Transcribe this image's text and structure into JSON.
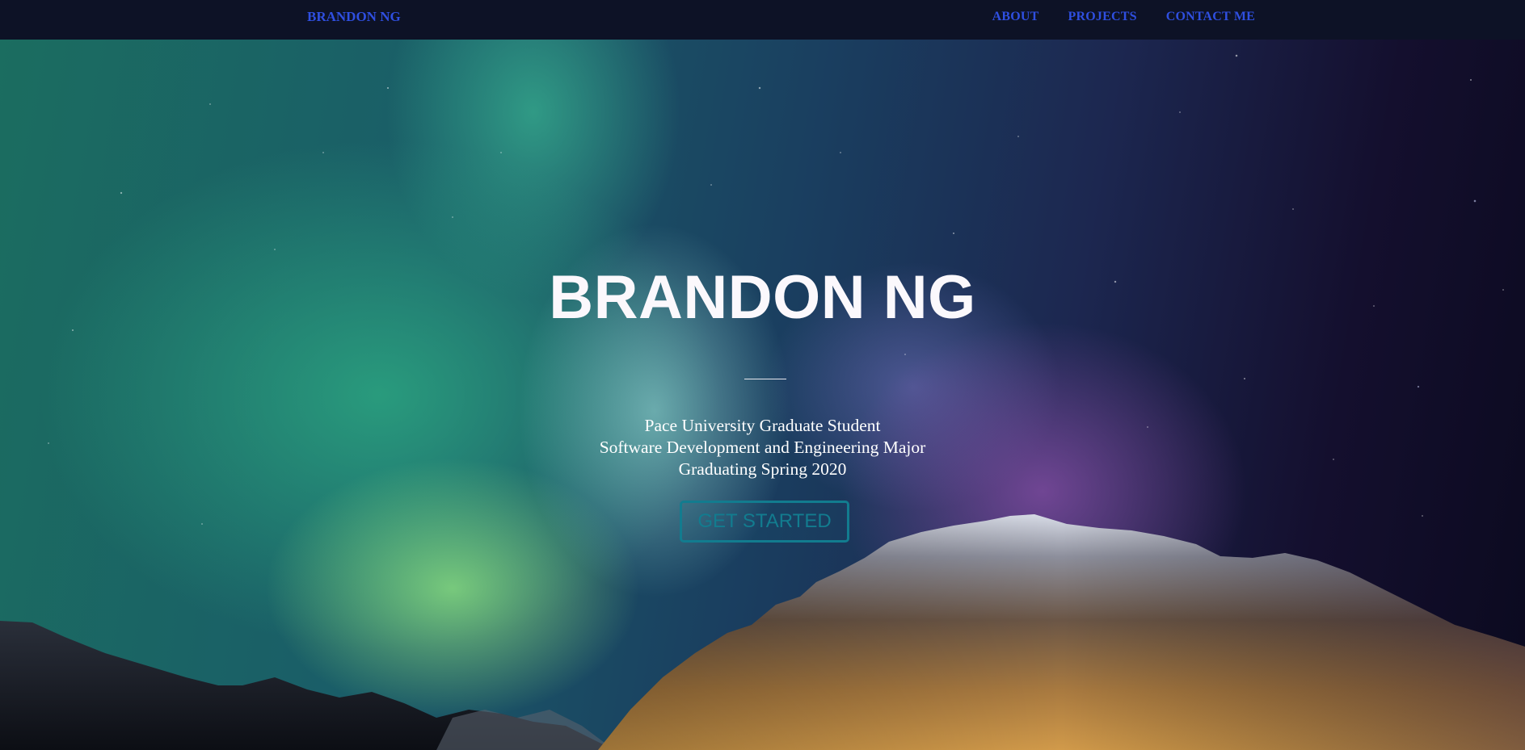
{
  "navbar": {
    "brand": "BRANDON NG",
    "links": [
      "ABOUT",
      "PROJECTS",
      "CONTACT ME"
    ]
  },
  "hero": {
    "title": "BRANDON NG",
    "subtitle_lines": [
      "Pace University Graduate Student",
      "Software Development and Engineering Major",
      "Graduating Spring 2020"
    ],
    "cta_label": "GET STARTED"
  },
  "colors": {
    "nav_background": "#0d1226",
    "nav_link": "#2f4fe0",
    "hero_text": "#fbf8fc",
    "cta_accent": "#127c8f"
  }
}
